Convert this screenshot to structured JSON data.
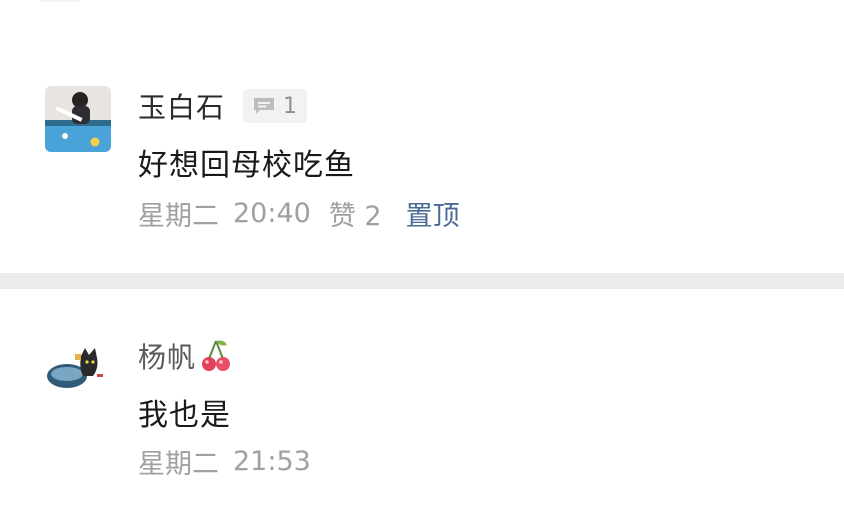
{
  "comments": [
    {
      "author": "玉白石",
      "reply_count": "1",
      "reply_icon": "comment-bubble-icon",
      "text": "好想回母校吃鱼",
      "day": "星期二",
      "time": "20:40",
      "likes": "赞 2",
      "pin_label": "置顶"
    },
    {
      "author": "杨帆",
      "author_badge": "cherry-emoji-icon",
      "text": "我也是",
      "day": "星期二",
      "time": "21:53"
    }
  ],
  "colors": {
    "pin_link": "#4a6a96",
    "meta_grey": "#a0a0a0",
    "divider": "#ececec"
  }
}
